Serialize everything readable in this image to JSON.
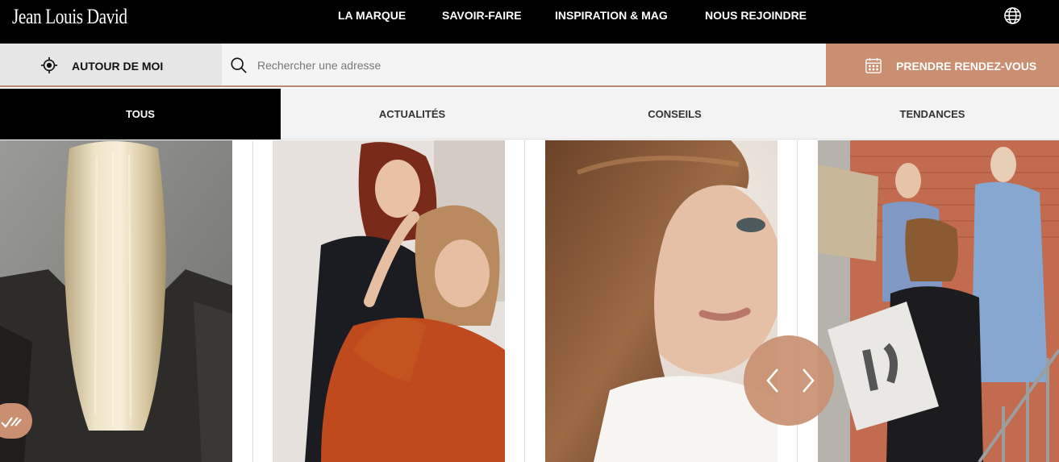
{
  "header": {
    "logo": "Jean Louis David",
    "nav": [
      "LA MARQUE",
      "SAVOIR-FAIRE",
      "INSPIRATION & MAG",
      "NOUS REJOINDRE"
    ],
    "language_icon": "globe-icon"
  },
  "search_bar": {
    "around_me_label": "AUTOUR DE MOI",
    "placeholder": "Rechercher une adresse",
    "appointment_label": "PRENDRE RENDEZ-VOUS"
  },
  "tabs": [
    {
      "label": "TOUS",
      "active": true
    },
    {
      "label": "ACTUALITÉS",
      "active": false
    },
    {
      "label": "CONSEILS",
      "active": false
    },
    {
      "label": "TENDANCES",
      "active": false
    }
  ],
  "cards": [
    {
      "image": "blonde long straight hair seen from behind, black leather jacket"
    },
    {
      "image": "hairdresser styling a woman's hair"
    },
    {
      "image": "close-up portrait of a woman with brown wavy hair"
    },
    {
      "image": "group of models with protest signs on stairs"
    }
  ],
  "colors": {
    "accent": "#c98f70",
    "topbar": "#000000",
    "tabs_bg": "#f3f3f3"
  }
}
